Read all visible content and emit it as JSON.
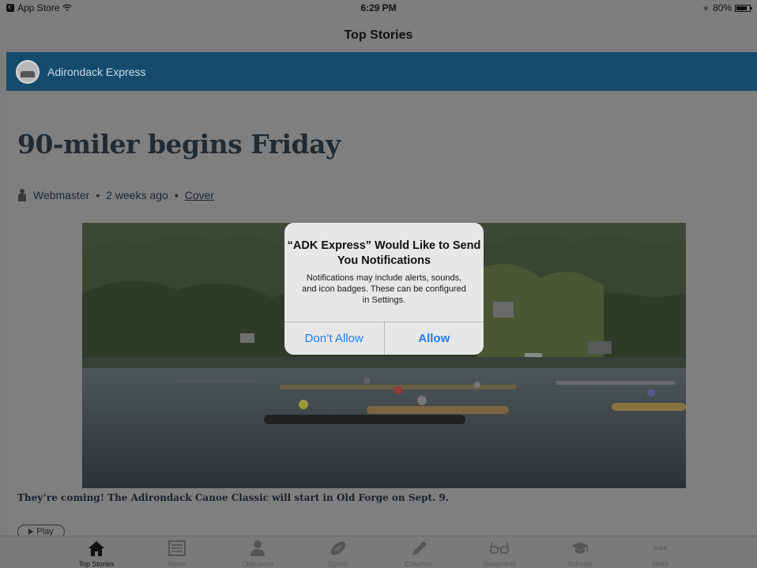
{
  "status_bar": {
    "back_app": "App Store",
    "time": "6:29 PM",
    "battery": "80%",
    "battery_level": 0.8
  },
  "nav": {
    "title": "Top Stories"
  },
  "site": {
    "name": "Adirondack Express"
  },
  "article": {
    "headline": "90-miler begins Friday",
    "author": "Webmaster",
    "age": "2 weeks ago",
    "category": "Cover",
    "caption": "They’re coming! The Adirondack Canoe Classic will start in Old Forge on Sept. 9.",
    "play_label": "Play"
  },
  "dialog": {
    "title": "“ADK Express” Would Like to Send You Notifications",
    "message": "Notifications may include alerts, sounds, and icon badges. These can be configured in Settings.",
    "deny_label": "Don’t Allow",
    "allow_label": "Allow"
  },
  "tabs": [
    {
      "label": "Top Stories",
      "icon": "home-icon",
      "active": true
    },
    {
      "label": "News",
      "icon": "newspaper-icon"
    },
    {
      "label": "Obituaries",
      "icon": "person-icon"
    },
    {
      "label": "Sports",
      "icon": "football-icon"
    },
    {
      "label": "Columns",
      "icon": "pencil-icon"
    },
    {
      "label": "Viewpoints",
      "icon": "glasses-icon"
    },
    {
      "label": "Schools",
      "icon": "graduation-cap-icon"
    },
    {
      "label": "More",
      "icon": "more-icon"
    }
  ],
  "colors": {
    "site_header": "#154c6e",
    "dialog_button": "#1f7cf2",
    "headline": "#1f2b35"
  }
}
